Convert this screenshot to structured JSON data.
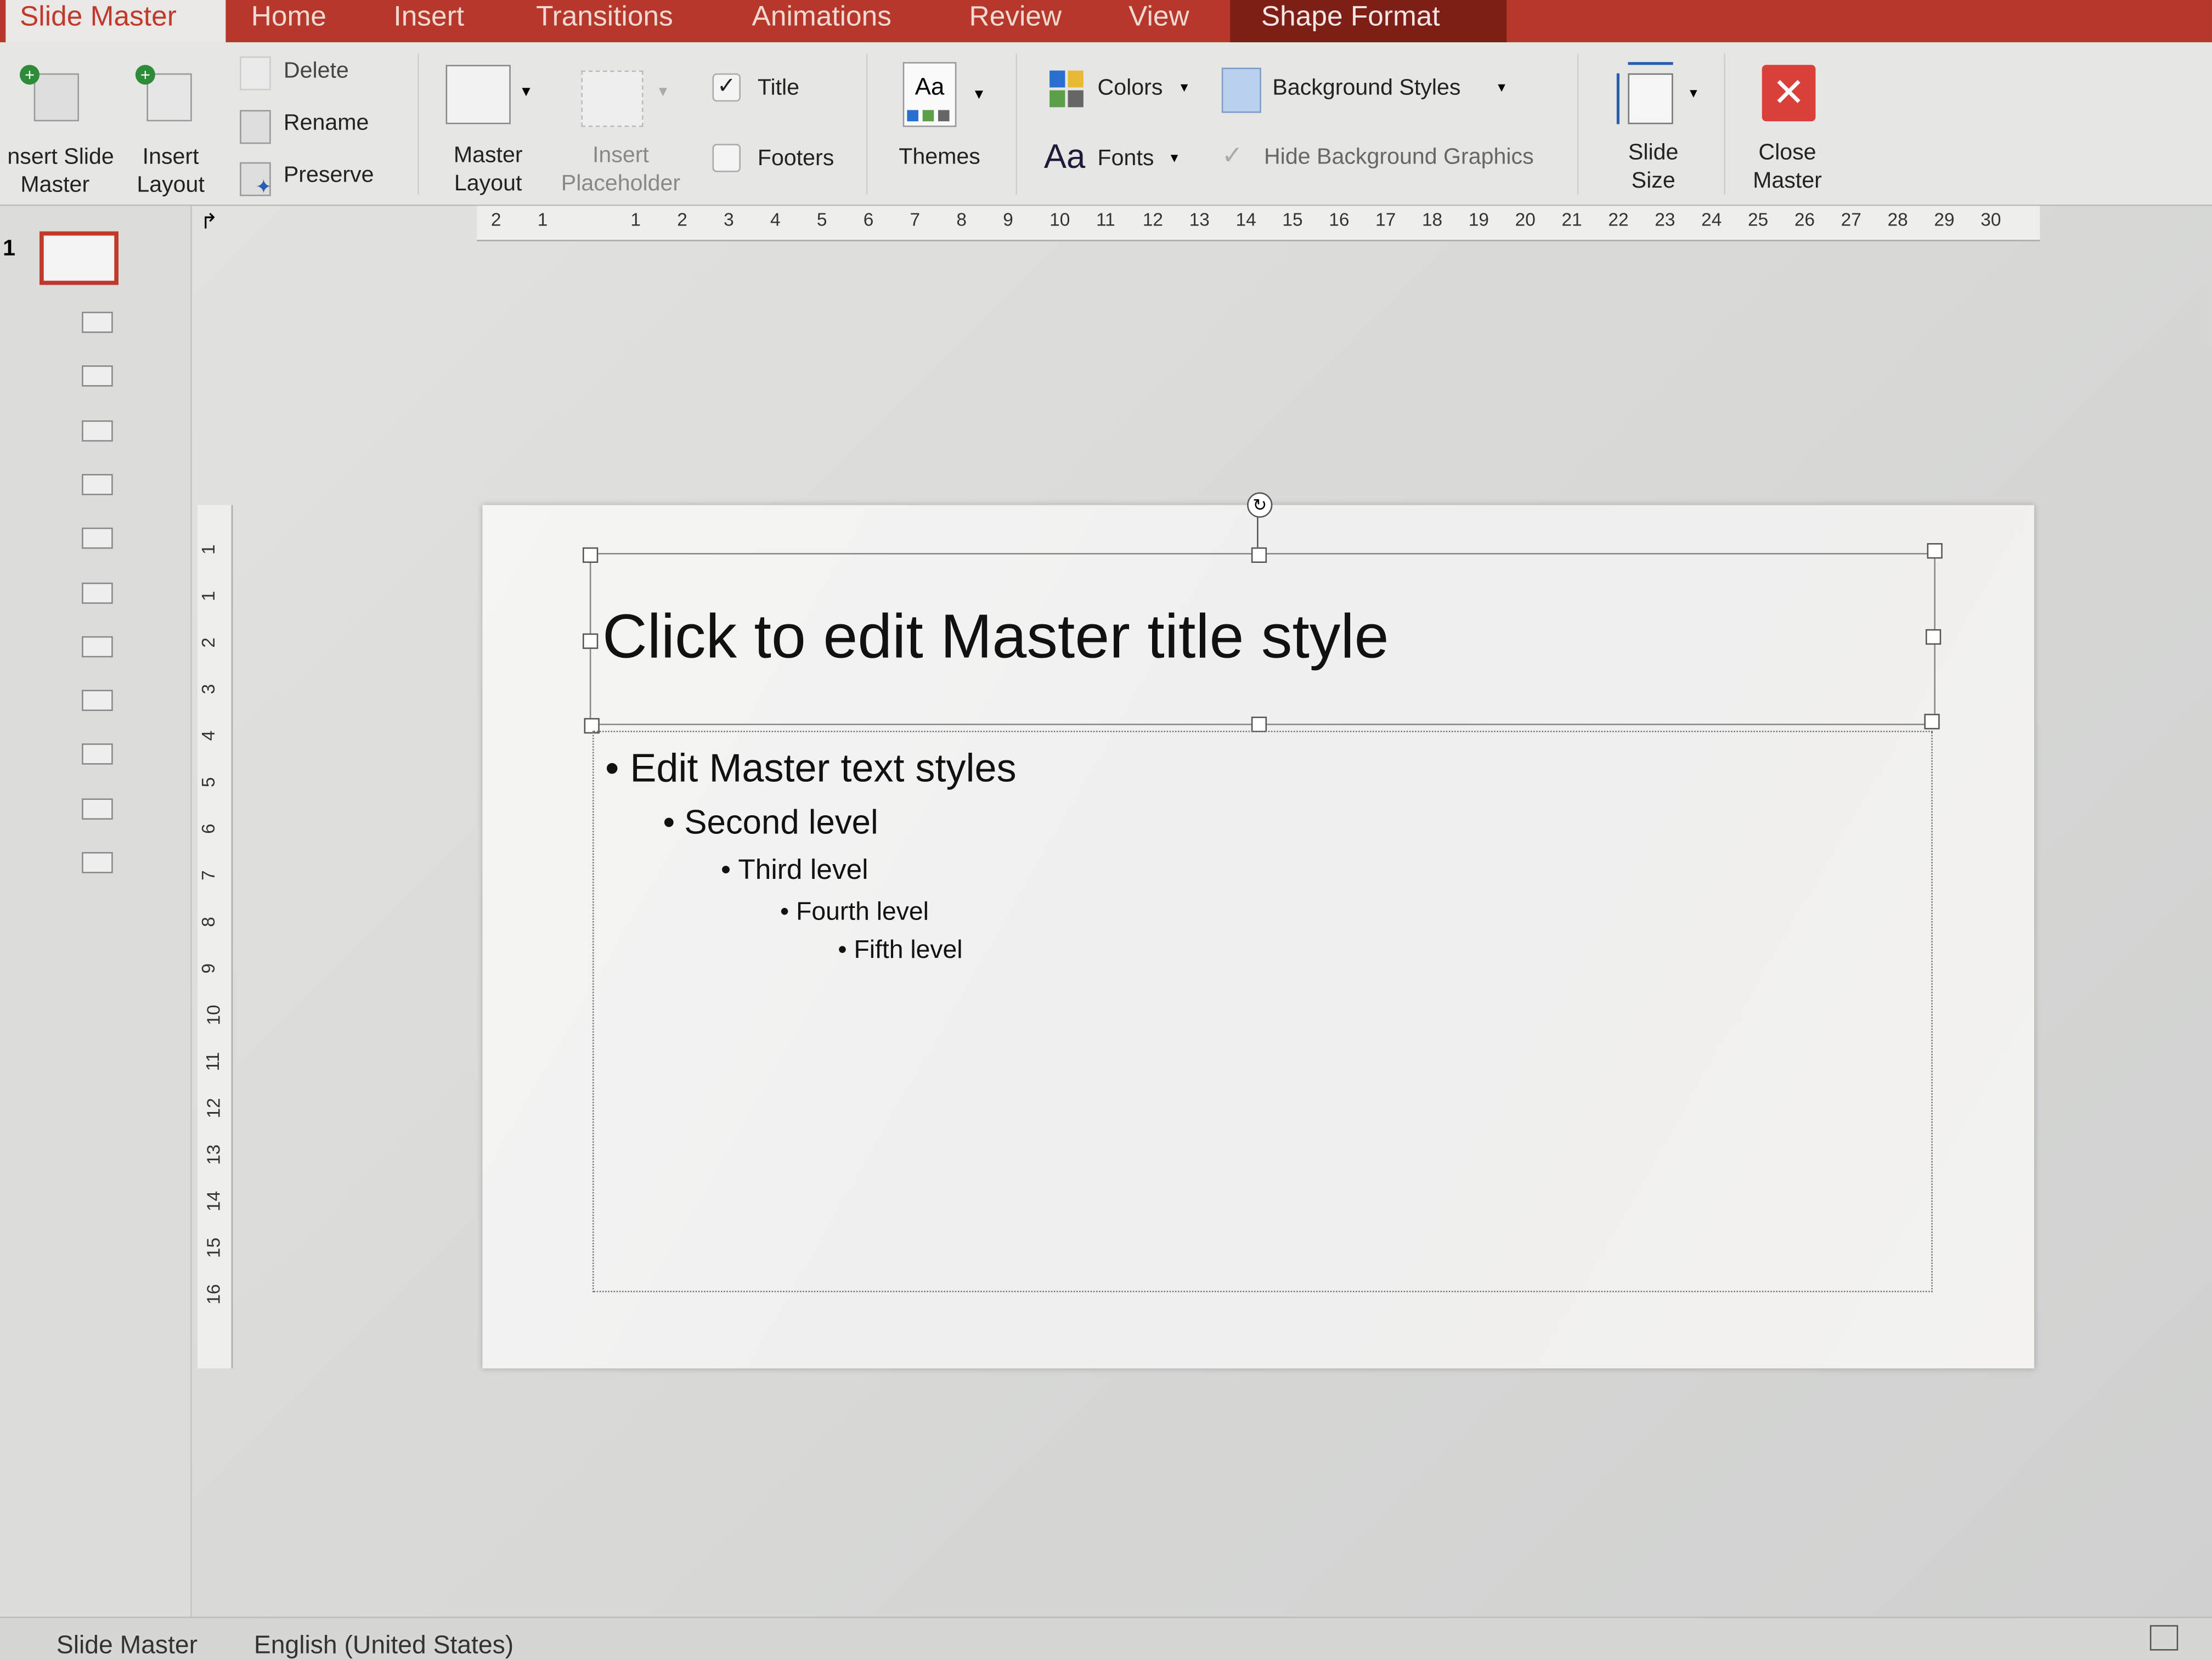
{
  "tabs": [
    {
      "label": "Slide Master",
      "state": "active"
    },
    {
      "label": "Home"
    },
    {
      "label": "Insert"
    },
    {
      "label": "Transitions"
    },
    {
      "label": "Animations"
    },
    {
      "label": "Review"
    },
    {
      "label": "View"
    },
    {
      "label": "Shape Format",
      "state": "contextual"
    }
  ],
  "ribbon": {
    "insert_slide_master": "Insert Slide Master",
    "insert_slide_master_l1": "nsert Slide",
    "insert_slide_master_l2": "Master",
    "insert_layout_l1": "Insert",
    "insert_layout_l2": "Layout",
    "delete": "Delete",
    "rename": "Rename",
    "preserve": "Preserve",
    "master_layout_l1": "Master",
    "master_layout_l2": "Layout",
    "insert_placeholder_l1": "Insert",
    "insert_placeholder_l2": "Placeholder",
    "title_checkbox": {
      "label": "Title",
      "checked": true
    },
    "footers_checkbox": {
      "label": "Footers",
      "checked": false
    },
    "themes": "Themes",
    "colors": "Colors",
    "fonts": "Fonts",
    "fonts_glyph": "Aa",
    "themes_glyph": "Aa",
    "background_styles": "Background Styles",
    "hide_background_graphics": {
      "label": "Hide Background Graphics",
      "checked": true,
      "enabled": false
    },
    "slide_size_l1": "Slide",
    "slide_size_l2": "Size",
    "close_master_l1": "Close",
    "close_master_l2": "Master"
  },
  "colors": {
    "accent": "#b5382a",
    "contextual_tab": "#7e1f17",
    "close": "#d9403a"
  },
  "slide_panel": {
    "master_number": "1",
    "layout_count": 11
  },
  "hruler": [
    "2",
    "1",
    "1",
    "2",
    "3",
    "4",
    "5",
    "6",
    "7",
    "8",
    "9",
    "10",
    "11",
    "12",
    "13",
    "14",
    "15",
    "16",
    "17",
    "18",
    "19",
    "20",
    "21",
    "22",
    "23",
    "24",
    "25",
    "26",
    "27",
    "28",
    "29",
    "30"
  ],
  "vruler": [
    "1",
    "1",
    "2",
    "3",
    "4",
    "5",
    "6",
    "7",
    "8",
    "9",
    "10",
    "11",
    "12",
    "13",
    "14",
    "15",
    "16"
  ],
  "slide": {
    "title": "Click to edit Master title style",
    "levels": [
      "Edit Master text styles",
      "Second level",
      "Third level",
      "Fourth level",
      "Fifth level"
    ]
  },
  "status": {
    "view": "Slide Master",
    "language": "English (United States)"
  }
}
